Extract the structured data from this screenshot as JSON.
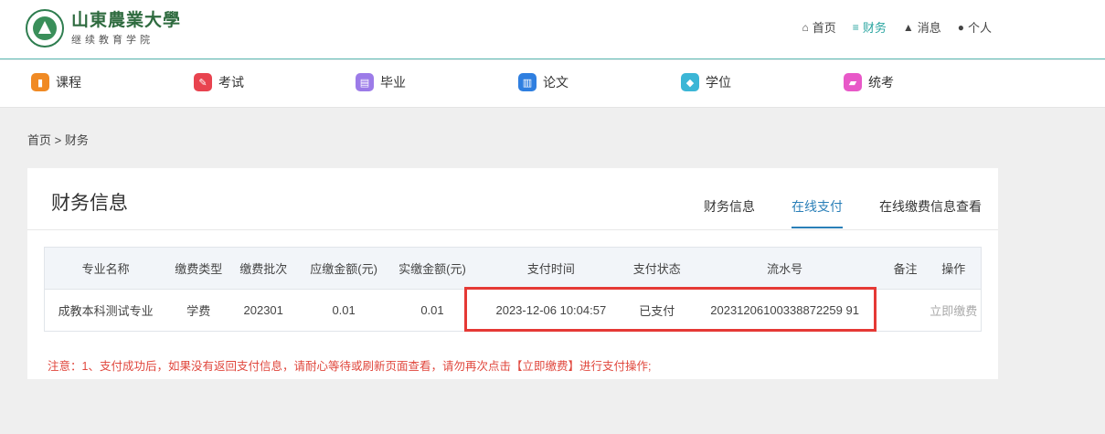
{
  "header": {
    "logo_cn": "山東農業大學",
    "logo_sub": "继续教育学院",
    "nav": [
      {
        "icon": "home-icon",
        "glyph": "⌂",
        "label": "首页",
        "active": false
      },
      {
        "icon": "database-icon",
        "glyph": "≡",
        "label": "财务",
        "active": true
      },
      {
        "icon": "bell-icon",
        "glyph": "▲",
        "label": "消息",
        "active": false
      },
      {
        "icon": "user-icon",
        "glyph": "●",
        "label": "个人",
        "active": false
      }
    ]
  },
  "modules": [
    {
      "label": "课程",
      "icon": "book-icon",
      "color": "#f08a24"
    },
    {
      "label": "考试",
      "icon": "pen-icon",
      "color": "#e8434f"
    },
    {
      "label": "毕业",
      "icon": "certificate-icon",
      "color": "#9c7be8"
    },
    {
      "label": "论文",
      "icon": "document-icon",
      "color": "#2f7fe0"
    },
    {
      "label": "学位",
      "icon": "graduation-cap-icon",
      "color": "#3bb6d6"
    },
    {
      "label": "统考",
      "icon": "folder-icon",
      "color": "#e858c8"
    }
  ],
  "breadcrumb": "首页 > 财务",
  "card": {
    "title": "财务信息",
    "tabs": [
      "财务信息",
      "在线支付",
      "在线缴费信息查看"
    ],
    "active_tab": 1
  },
  "table": {
    "headers": [
      "专业名称",
      "缴费类型",
      "缴费批次",
      "应缴金额(元)",
      "实缴金额(元)",
      "支付时间",
      "支付状态",
      "流水号",
      "备注",
      "操作"
    ],
    "rows": [
      [
        "成教本科测试专业",
        "学费",
        "202301",
        "0.01",
        "0.01",
        "2023-12-06 10:04:57",
        "已支付",
        "20231206100338872259 91",
        "",
        "立即缴费"
      ]
    ]
  },
  "note": "注意：1、支付成功后，如果没有返回支付信息，请耐心等待或刷新页面查看，请勿再次点击【立即缴费】进行支付操作;"
}
